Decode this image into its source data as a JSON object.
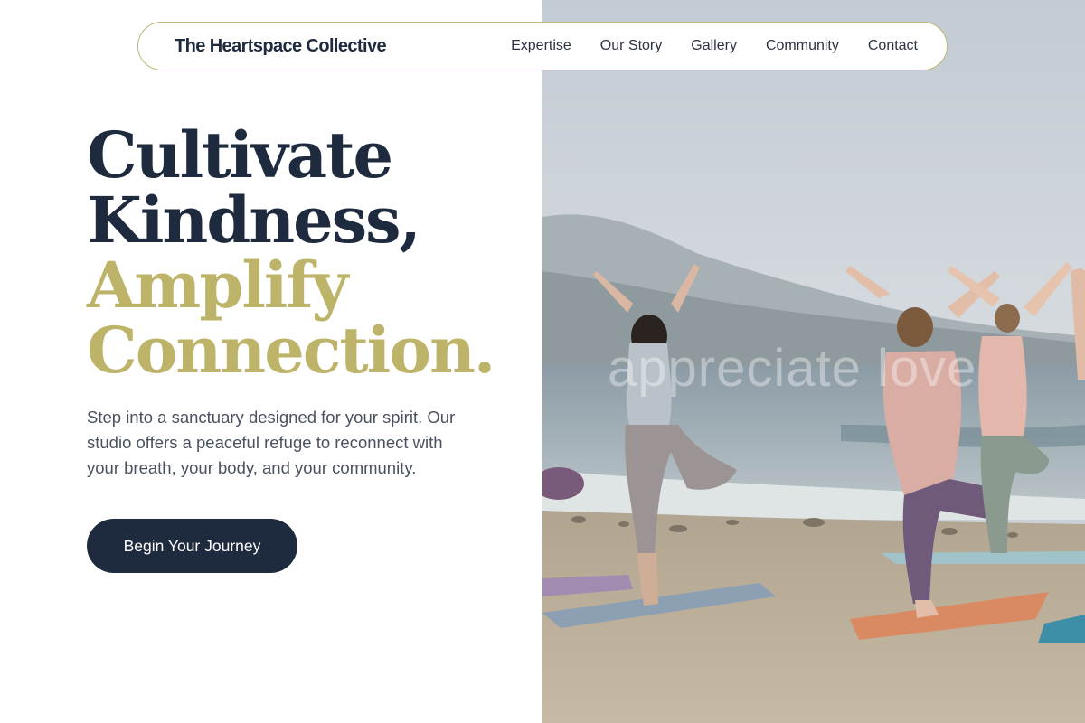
{
  "nav": {
    "brand": "The Heartspace Collective",
    "links": [
      "Expertise",
      "Our Story",
      "Gallery",
      "Community",
      "Contact"
    ]
  },
  "hero": {
    "headline_line1": "Cultivate",
    "headline_line2": "Kindness,",
    "headline_line3": "Amplify",
    "headline_line4": "Connection.",
    "intro": "Step into a sanctuary designed for your spirit. Our studio offers a peaceful refuge to reconnect with your breath, your body, and your community.",
    "cta_label": "Begin Your Journey"
  },
  "photo": {
    "watermark": "appreciate love"
  },
  "colors": {
    "navy": "#1e2a3d",
    "gold": "#bdb46a",
    "body_text": "#4a5260"
  }
}
